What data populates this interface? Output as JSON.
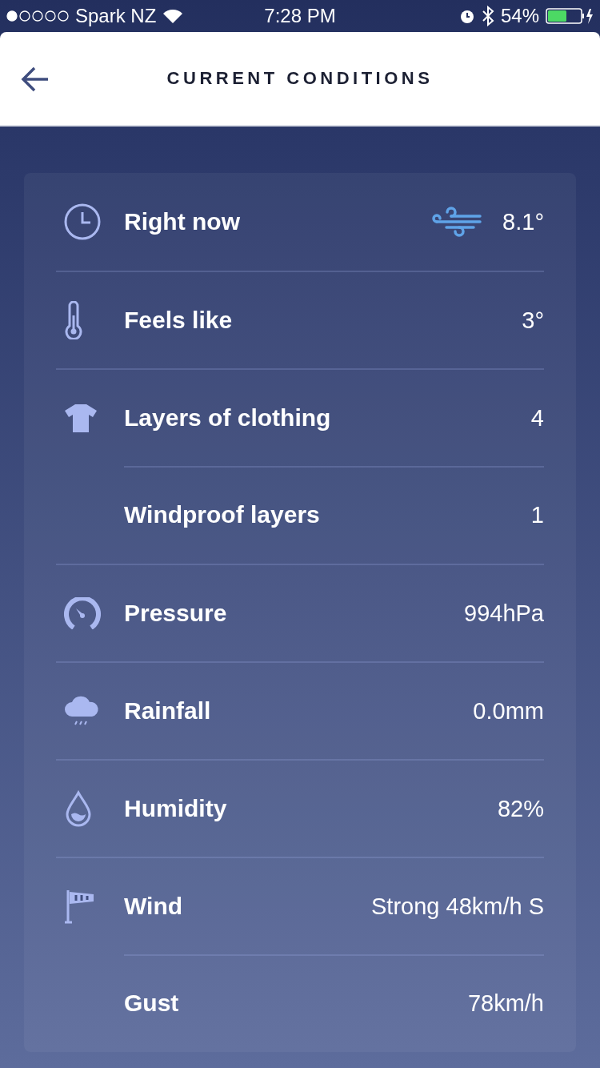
{
  "status_bar": {
    "carrier": "Spark NZ",
    "time": "7:28 PM",
    "battery": "54%"
  },
  "header": {
    "title": "CURRENT CONDITIONS"
  },
  "rows": [
    {
      "label": "Right now",
      "value": "8.1°",
      "sub": false
    },
    {
      "label": "Feels like",
      "value": "3°",
      "sub": false
    },
    {
      "label": "Layers of clothing",
      "value": "4",
      "sub": false
    },
    {
      "label": "Windproof layers",
      "value": "1",
      "sub": true
    },
    {
      "label": "Pressure",
      "value": "994hPa",
      "sub": false
    },
    {
      "label": "Rainfall",
      "value": "0.0mm",
      "sub": false
    },
    {
      "label": "Humidity",
      "value": "82%",
      "sub": false
    },
    {
      "label": "Wind",
      "value": "Strong 48km/h S",
      "sub": false
    },
    {
      "label": "Gust",
      "value": "78km/h",
      "sub": true
    }
  ]
}
